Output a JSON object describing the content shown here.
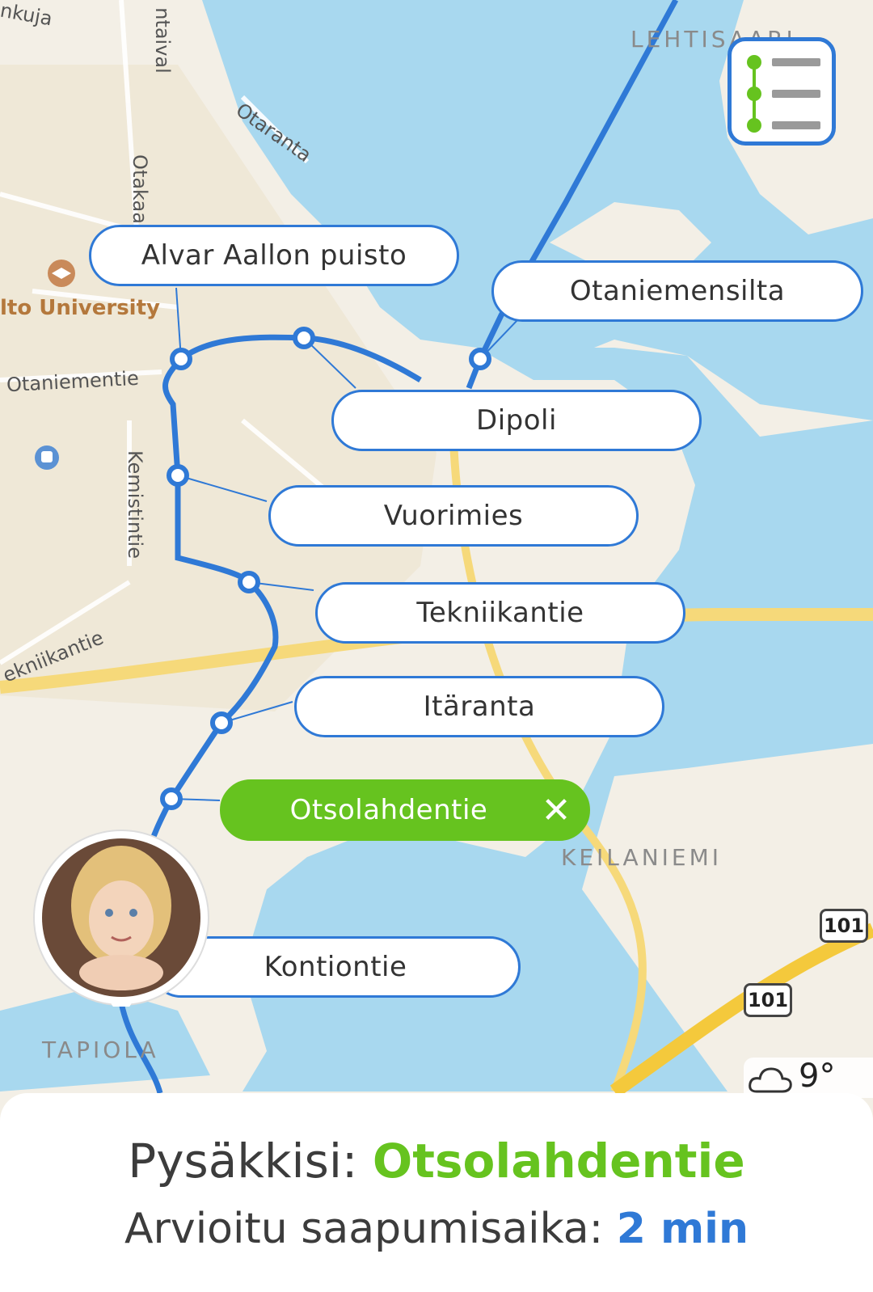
{
  "map": {
    "place_labels": {
      "aalto": "lto University",
      "otaniementie": "Otaniementie",
      "otaranta": "Otaranta",
      "otakaari": "Otakaa",
      "kemistintie": "Kemistintie",
      "tekniikantie": "ekniikantie",
      "laivalahdentaival": "ntaival",
      "nkuja": "nkuja"
    },
    "districts": {
      "lehtisaari": "LEHTISAARI",
      "keilaniemi": "KEILANIEMI",
      "tapiola": "TAPIOLA"
    },
    "road_shields": [
      "101",
      "101"
    ]
  },
  "stops": [
    {
      "name": "Alvar Aallon puisto"
    },
    {
      "name": "Otaniemensilta"
    },
    {
      "name": "Dipoli"
    },
    {
      "name": "Vuorimies"
    },
    {
      "name": "Tekniikantie"
    },
    {
      "name": "Itäranta"
    },
    {
      "name": "Otsolahdentie",
      "selected": true
    },
    {
      "name": "Kontiontie"
    }
  ],
  "weather": {
    "temp": "9°",
    "icon": "cloud-icon"
  },
  "bottom": {
    "stop_prefix": "Pysäkkisi: ",
    "stop_name": "Otsolahdentie",
    "eta_prefix": "Arvioitu saapumisaika: ",
    "eta_value": "2 min"
  },
  "colors": {
    "route": "#2f79d6",
    "selected": "#66c31f",
    "water": "#a8d8ef",
    "land": "#f3efe6"
  }
}
